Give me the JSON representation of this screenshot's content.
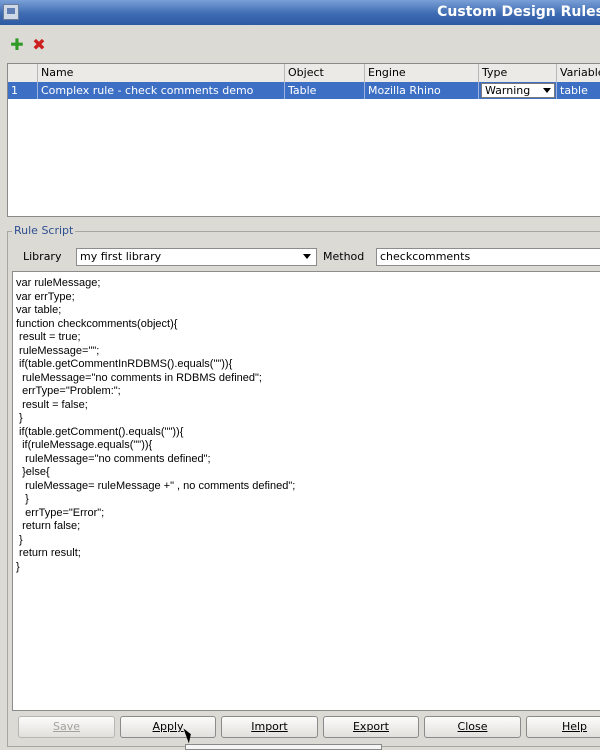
{
  "window": {
    "title": "Custom Design Rules"
  },
  "toolbar": {
    "add_icon": "plus-icon",
    "delete_icon": "delete-x-icon"
  },
  "table": {
    "columns": [
      "Name",
      "Object",
      "Engine",
      "Type",
      "Variable"
    ],
    "rows": [
      {
        "index": "1",
        "name": "Complex rule - check comments demo",
        "object": "Table",
        "engine": "Mozilla Rhino",
        "type": "Warning",
        "variable": "table"
      }
    ]
  },
  "rule_script": {
    "legend": "Rule Script",
    "library_label": "Library",
    "library_value": "my first library",
    "method_label": "Method",
    "method_value": "checkcomments",
    "code": "var ruleMessage;\nvar errType;\nvar table;\nfunction checkcomments(object){\n result = true;\n ruleMessage=\"\";\n if(table.getCommentInRDBMS().equals(\"\")){\n  ruleMessage=\"no comments in RDBMS defined\";\n  errType=\"Problem:\";\n  result = false;\n }\n if(table.getComment().equals(\"\")){\n  if(ruleMessage.equals(\"\")){\n   ruleMessage=\"no comments defined\";\n  }else{\n   ruleMessage= ruleMessage +\" , no comments defined\";\n   }\n   errType=\"Error\";\n  return false;\n }\n return result;\n}"
  },
  "buttons": {
    "save": "Save",
    "apply": "Apply",
    "import": "Import",
    "export": "Export",
    "close": "Close",
    "help": "Help"
  }
}
